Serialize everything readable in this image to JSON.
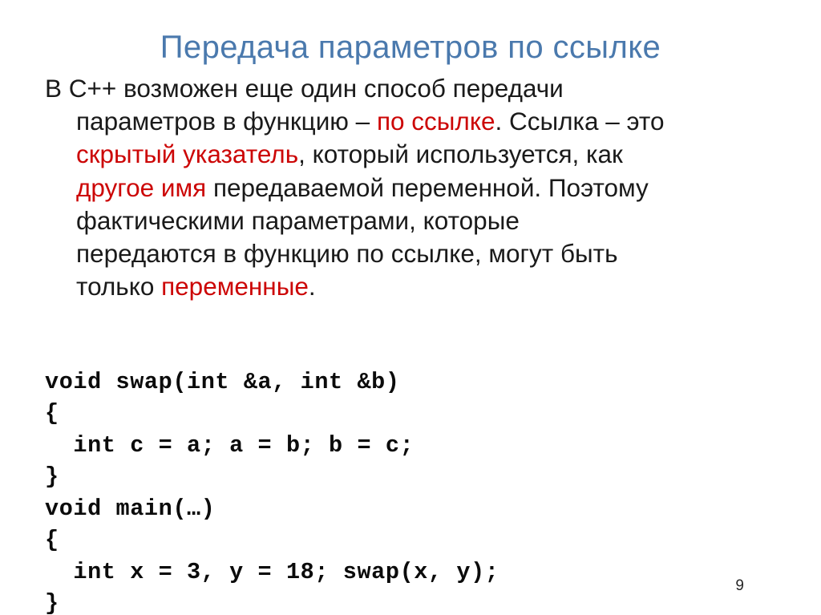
{
  "slide": {
    "title": "Передача параметров по ссылке",
    "number": "9",
    "accent_title_color": "#4a79ad",
    "highlight_color": "#cc0505",
    "body_color": "#1a1a1a",
    "background_color": "#ffffff"
  },
  "body": {
    "lines": [
      {
        "indent": false,
        "runs": [
          {
            "text": "В С++ возможен еще один способ передачи",
            "style": "normal"
          }
        ]
      },
      {
        "indent": true,
        "runs": [
          {
            "text": "параметров в функцию – ",
            "style": "normal"
          },
          {
            "text": "по ссылке",
            "style": "highlight"
          },
          {
            "text": ". Ссылка – это",
            "style": "normal"
          }
        ]
      },
      {
        "indent": true,
        "runs": [
          {
            "text": "скрытый указатель",
            "style": "highlight"
          },
          {
            "text": ", который используется, как",
            "style": "normal"
          }
        ]
      },
      {
        "indent": true,
        "runs": [
          {
            "text": "другое имя",
            "style": "highlight"
          },
          {
            "text": " передаваемой переменной. Поэтому",
            "style": "normal"
          }
        ]
      },
      {
        "indent": true,
        "runs": [
          {
            "text": "фактическими параметрами, которые",
            "style": "normal"
          }
        ]
      },
      {
        "indent": true,
        "runs": [
          {
            "text": "передаются в функцию по ссылке, могут быть",
            "style": "normal"
          }
        ]
      },
      {
        "indent": true,
        "runs": [
          {
            "text": "только ",
            "style": "normal"
          },
          {
            "text": "переменные",
            "style": "highlight"
          },
          {
            "text": ".",
            "style": "normal"
          }
        ]
      }
    ]
  },
  "code": {
    "language": "C++",
    "lines": [
      "void swap(int &a, int &b)",
      "{",
      "  int c = a; a = b; b = c;",
      "}",
      "void main(…)",
      "{",
      "  int x = 3, y = 18; swap(x, y);",
      "}"
    ]
  }
}
